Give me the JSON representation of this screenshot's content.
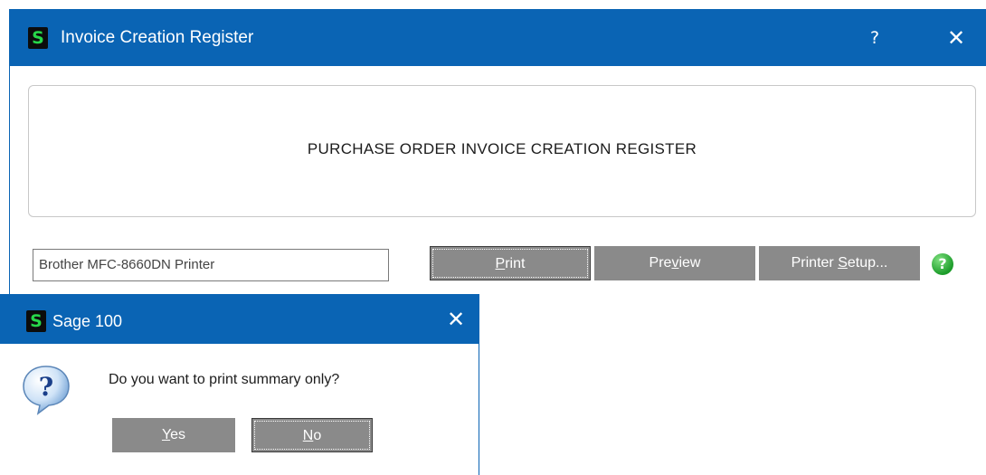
{
  "main_window": {
    "title": "Invoice Creation Register",
    "app_icon_letter": "S",
    "help_glyph": "?",
    "close_glyph": "✕",
    "banner_text": "PURCHASE ORDER INVOICE CREATION REGISTER",
    "printer_name": "Brother MFC-8660DN Printer",
    "buttons": {
      "print": {
        "before": "",
        "accel": "P",
        "after": "rint"
      },
      "preview": {
        "before": "Pre",
        "accel": "v",
        "after": "iew"
      },
      "printer_setup": {
        "before": "Printer ",
        "accel": "S",
        "after": "etup..."
      }
    },
    "help_icon_glyph": "?"
  },
  "dialog": {
    "title": "Sage 100",
    "app_icon_letter": "S",
    "close_glyph": "✕",
    "message": "Do you want to print summary only?",
    "buttons": {
      "yes": {
        "accel": "Y",
        "after": "es"
      },
      "no": {
        "accel": "N",
        "after": "o"
      }
    }
  },
  "colors": {
    "titlebar": "#0a64b4",
    "button_gray": "#8a8a8a",
    "app_icon_green": "#27d84a",
    "help_green": "#1c9c2a"
  },
  "icons": {
    "app": "sage-s-icon",
    "help": "question-circle-icon",
    "dialog_question": "question-bubble-icon"
  }
}
